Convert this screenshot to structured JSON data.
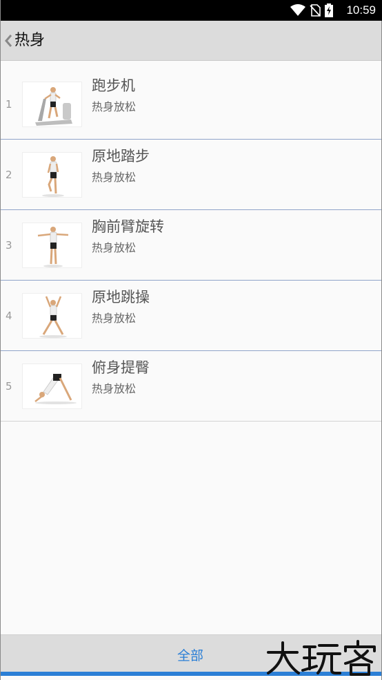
{
  "status_bar": {
    "time": "10:59"
  },
  "header": {
    "title": "热身"
  },
  "items": [
    {
      "index": "1",
      "title": "跑步机",
      "subtitle": "热身放松"
    },
    {
      "index": "2",
      "title": "原地踏步",
      "subtitle": "热身放松"
    },
    {
      "index": "3",
      "title": "胸前臂旋转",
      "subtitle": "热身放松"
    },
    {
      "index": "4",
      "title": "原地跳操",
      "subtitle": "热身放松"
    },
    {
      "index": "5",
      "title": "俯身提臀",
      "subtitle": "热身放松"
    }
  ],
  "footer": {
    "tab_label": "全部"
  },
  "watermark": {
    "text": "大玩客"
  },
  "colors": {
    "accent": "#2b7fd6",
    "divider": "#8fa3c9",
    "header_bg": "#dcdcdc"
  },
  "icons": [
    "wifi-icon",
    "no-sim-icon",
    "battery-charging-icon",
    "back-chevron-icon"
  ]
}
